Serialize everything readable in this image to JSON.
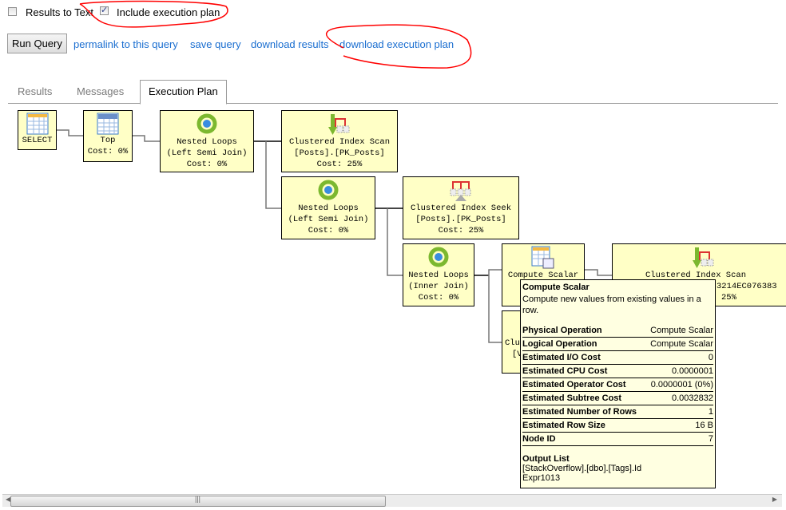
{
  "options": {
    "results_to_text": {
      "label": "Results to Text",
      "checked": false
    },
    "include_plan": {
      "label": "Include execution plan",
      "checked": true
    }
  },
  "toolbar": {
    "run": "Run Query",
    "links": [
      "permalink to this query",
      "save query",
      "download results",
      "download execution plan"
    ]
  },
  "tabs": [
    {
      "label": "Results"
    },
    {
      "label": "Messages"
    },
    {
      "label": "Execution Plan",
      "active": true
    }
  ],
  "nodes": {
    "select": [
      "SELECT"
    ],
    "top": [
      "Top",
      "Cost: 0%"
    ],
    "nl1": [
      "Nested Loops",
      "(Left Semi Join)",
      "Cost: 0%"
    ],
    "cis1": [
      "Clustered Index Scan",
      "[Posts].[PK_Posts]",
      "Cost: 25%"
    ],
    "nl2": [
      "Nested Loops",
      "(Left Semi Join)",
      "Cost: 0%"
    ],
    "seek": [
      "Clustered Index Seek",
      "[Posts].[PK_Posts]",
      "Cost: 25%"
    ],
    "nl3": [
      "Nested Loops",
      "(Inner Join)",
      "Cost: 0%"
    ],
    "cs": [
      "Compute Scalar"
    ],
    "cis2": [
      "Clustered Index Scan",
      "3214EC076383",
      "25%"
    ],
    "clu": [
      "Clu",
      "[V"
    ]
  },
  "tooltip": {
    "title": "Compute Scalar",
    "desc": "Compute new values from existing values in a row.",
    "rows": [
      {
        "k": "Physical Operation",
        "v": "Compute Scalar"
      },
      {
        "k": "Logical Operation",
        "v": "Compute Scalar"
      },
      {
        "k": "Estimated I/O Cost",
        "v": "0"
      },
      {
        "k": "Estimated CPU Cost",
        "v": "0.0000001"
      },
      {
        "k": "Estimated Operator Cost",
        "v": "0.0000001 (0%)"
      },
      {
        "k": "Estimated Subtree Cost",
        "v": "0.0032832"
      },
      {
        "k": "Estimated Number of Rows",
        "v": "1"
      },
      {
        "k": "Estimated Row Size",
        "v": "16 B"
      },
      {
        "k": "Node ID",
        "v": "7"
      }
    ],
    "output_title": "Output List",
    "output": [
      "[StackOverflow].[dbo].[Tags].Id",
      "Expr1013"
    ]
  },
  "colors": {
    "node_bg": "#ffffc6",
    "tooltip_bg": "#ffffe1",
    "link": "#1a6ed0",
    "annotation": "#ff0000"
  }
}
